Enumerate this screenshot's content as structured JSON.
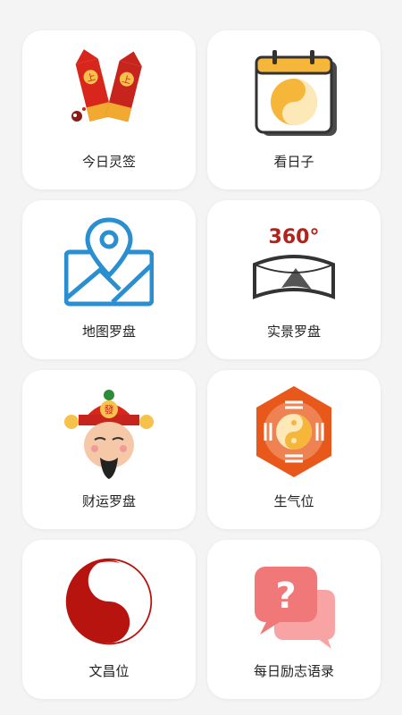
{
  "grid": {
    "items": [
      {
        "label": "今日灵签",
        "icon": "fortune-sticks-icon"
      },
      {
        "label": "看日子",
        "icon": "calendar-yinyang-icon"
      },
      {
        "label": "地图罗盘",
        "icon": "map-pin-icon"
      },
      {
        "label": "实景罗盘",
        "icon": "panorama-360-icon",
        "icon_text": "360°"
      },
      {
        "label": "财运罗盘",
        "icon": "god-of-wealth-icon",
        "icon_text": "發"
      },
      {
        "label": "生气位",
        "icon": "bagua-icon"
      },
      {
        "label": "文昌位",
        "icon": "wenchang-yinyang-icon"
      },
      {
        "label": "每日励志语录",
        "icon": "chat-question-icon",
        "icon_text": "?"
      }
    ]
  },
  "colors": {
    "red": "#c8241e",
    "orange": "#e8581a",
    "blue": "#2a8fd0",
    "yellow": "#f6b63a",
    "pink": "#f07878"
  }
}
